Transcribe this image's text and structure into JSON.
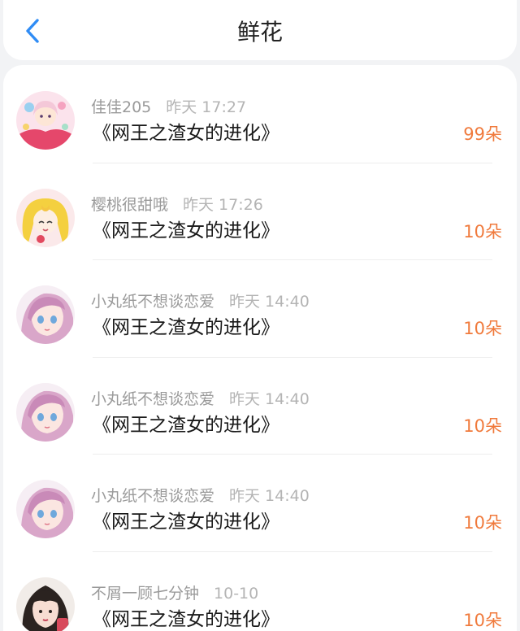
{
  "header": {
    "title": "鲜花",
    "back_icon": "chevron-left-icon",
    "accent_color": "#2f8cf5"
  },
  "flowers": [
    {
      "user": "佳佳205",
      "time": "昨天 17:27",
      "book": "《网王之渣女的进化》",
      "count": "99朵",
      "avatar": "pink-fairy-avatar"
    },
    {
      "user": "樱桃很甜哦",
      "time": "昨天 17:26",
      "book": "《网王之渣女的进化》",
      "count": "10朵",
      "avatar": "sailor-moon-avatar"
    },
    {
      "user": "小丸纸不想谈恋爱",
      "time": "昨天 14:40",
      "book": "《网王之渣女的进化》",
      "count": "10朵",
      "avatar": "anime-girl-avatar"
    },
    {
      "user": "小丸纸不想谈恋爱",
      "time": "昨天 14:40",
      "book": "《网王之渣女的进化》",
      "count": "10朵",
      "avatar": "anime-girl-avatar"
    },
    {
      "user": "小丸纸不想谈恋爱",
      "time": "昨天 14:40",
      "book": "《网王之渣女的进化》",
      "count": "10朵",
      "avatar": "anime-girl-avatar"
    },
    {
      "user": "不屑一顾七分钟",
      "time": "10-10",
      "book": "《网王之渣女的进化》",
      "count": "10朵",
      "avatar": "dark-hair-girl-avatar"
    }
  ],
  "colors": {
    "count": "#f07a3c",
    "username": "#9a9a9a",
    "timestamp": "#b4b4b4"
  }
}
